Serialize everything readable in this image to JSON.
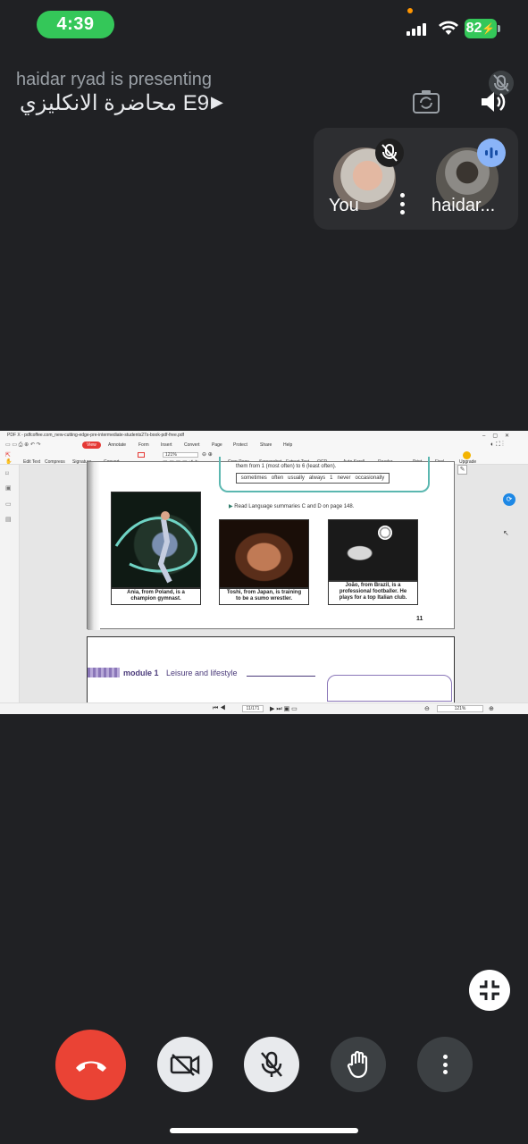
{
  "status_bar": {
    "time": "4:39",
    "battery": "82"
  },
  "meeting": {
    "presenter_text": "haidar ryad is presenting",
    "title": "محاضرة الانكليزي E9"
  },
  "participants": [
    {
      "label": "You",
      "muted": true
    },
    {
      "label": "haidar...",
      "speaking": true
    }
  ],
  "pdf": {
    "window_title": "PDF X - pdfcoffee.com_new-cutting-edge-pre-intermediate-students27s-book-pdf-free.pdf",
    "menu": [
      "View",
      "Annotate",
      "Form",
      "Insert",
      "Convert",
      "Page",
      "Protect",
      "Share",
      "Help"
    ],
    "tools": [
      "Edit Text",
      "Compress",
      "Signature",
      "Convert",
      "Crop Page",
      "Screenshot",
      "Extract Text",
      "OCR",
      "Auto Scroll",
      "Reader",
      "Print",
      "Find",
      "Upgrade"
    ],
    "zoom": "121%",
    "page_indicator": "11/171",
    "page_text": {
      "instruction": "them from 1 (most often) to 6 (least often).",
      "words": "sometimes   often   usually   always   1   never   occasionally",
      "reference": "Read Language summaries C and D on page 148.",
      "captions": [
        "Ania, from Poland, is a champion gymnast.",
        "Toshi, from Japan, is training to be a sumo wrestler.",
        "João, from Brazil, is a professional footballer. He plays for a top Italian club."
      ],
      "page_number": "11",
      "next_module": "module 1",
      "next_title": "Leisure and lifestyle"
    }
  }
}
